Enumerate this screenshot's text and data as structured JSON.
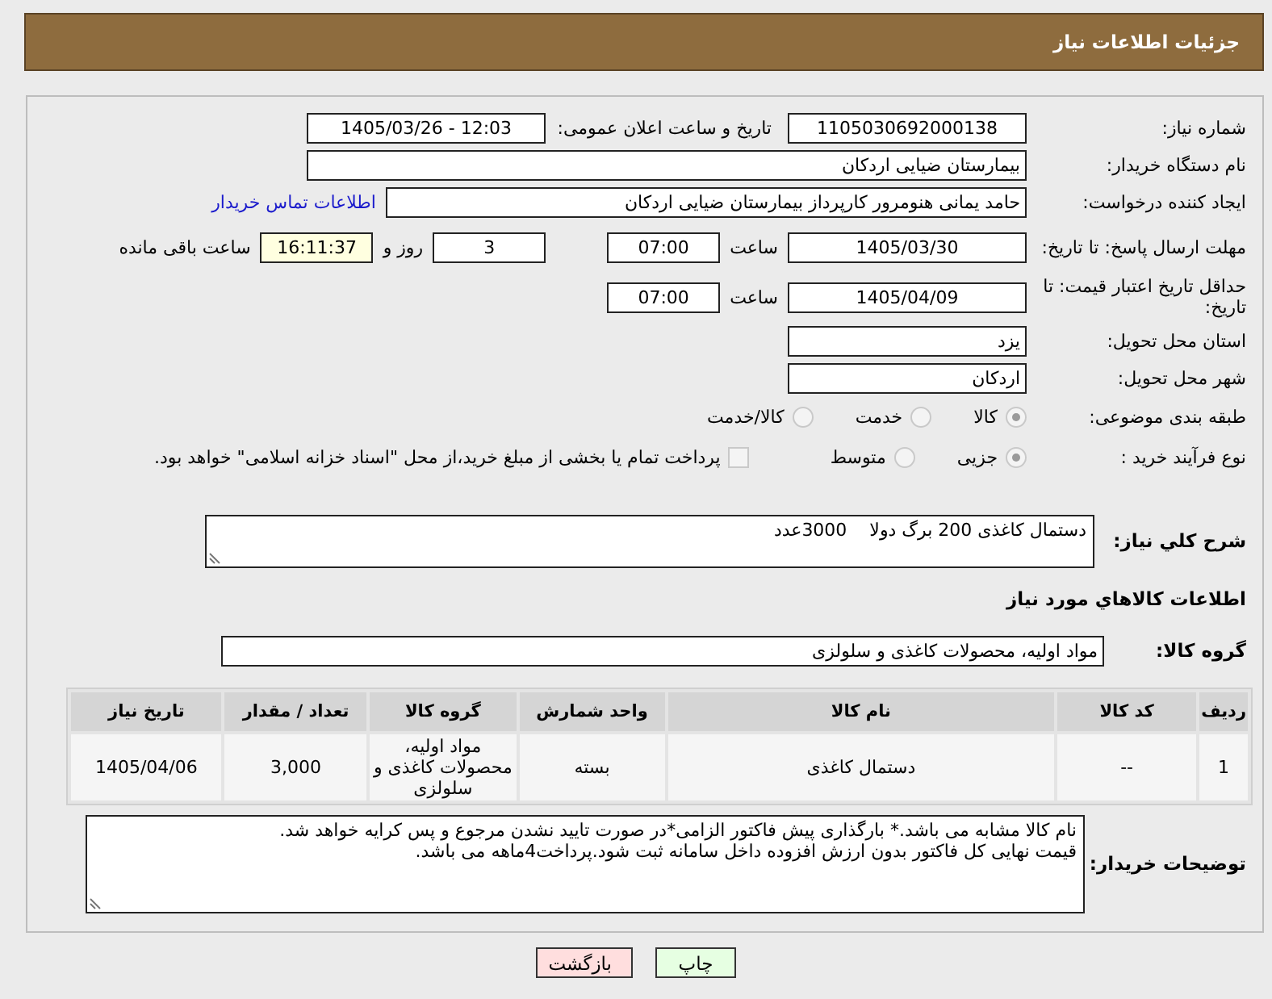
{
  "header": {
    "title": "جزئیات اطلاعات نیاز"
  },
  "need_number": {
    "label": "شماره نیاز:",
    "value": "1105030692000138"
  },
  "announce": {
    "label": "تاریخ و ساعت اعلان عمومی:",
    "value": "1405/03/26 - 12:03"
  },
  "buyer_org": {
    "label": "نام دستگاه خریدار:",
    "value": "بیمارستان ضیایی اردکان"
  },
  "requester": {
    "label": "ایجاد کننده درخواست:",
    "value": "حامد یمانی هنومرور کارپرداز بیمارستان ضیایی اردکان",
    "link": "اطلاعات تماس خریدار"
  },
  "reply_deadline": {
    "label": "مهلت ارسال پاسخ: تا تاریخ:",
    "date": "1405/03/30",
    "time_label": "ساعت",
    "time": "07:00",
    "days": "3",
    "days_label": "روز و",
    "remaining": "16:11:37",
    "remaining_label": "ساعت باقی مانده"
  },
  "price_validity": {
    "label": "حداقل تاریخ اعتبار قیمت: تا تاریخ:",
    "date": "1405/04/09",
    "time_label": "ساعت",
    "time": "07:00"
  },
  "province": {
    "label": "استان محل تحویل:",
    "value": "یزد"
  },
  "city": {
    "label": "شهر محل تحویل:",
    "value": "اردکان"
  },
  "category": {
    "label": "طبقه بندی موضوعی:",
    "options": [
      {
        "label": "کالا",
        "selected": true
      },
      {
        "label": "خدمت",
        "selected": false
      },
      {
        "label": "کالا/خدمت",
        "selected": false
      }
    ]
  },
  "process": {
    "label": "نوع فرآیند خرید :",
    "options": [
      {
        "label": "جزیی",
        "selected": true
      },
      {
        "label": "متوسط",
        "selected": false
      }
    ],
    "payment": {
      "label": "پرداخت تمام یا بخشی از مبلغ خرید،از محل \"اسناد خزانه اسلامی\" خواهد بود.",
      "checked": false
    }
  },
  "description": {
    "label": "شرح کلي نياز:",
    "value": "دستمال کاغذی 200 برگ دولا    3000عدد"
  },
  "items_heading": "اطلاعات کالاهاي مورد نياز",
  "goods_group": {
    "label": "گروه کالا:",
    "value": "مواد اولیه، محصولات کاغذی و سلولزی"
  },
  "table": {
    "columns": [
      "ردیف",
      "کد کالا",
      "نام کالا",
      "واحد شمارش",
      "گروه کالا",
      "تعداد / مقدار",
      "تاریخ نیاز"
    ],
    "rows": [
      [
        "1",
        "--",
        "دستمال کاغذی",
        "بسته",
        "مواد اولیه، محصولات کاغذی و سلولزی",
        "3,000",
        "1405/04/06"
      ]
    ]
  },
  "buyer_notes": {
    "label": "توضیحات خریدار:",
    "lines": [
      "نام کالا مشابه می باشد.* بارگذاری پیش فاکتور الزامی*در صورت تایید نشدن مرجوع و پس کرایه خواهد شد.",
      "قیمت نهایی کل فاکتور بدون ارزش افزوده داخل سامانه ثبت شود.پرداخت4ماهه می باشد."
    ]
  },
  "buttons": [
    {
      "label": "چاپ",
      "kind": "print"
    },
    {
      "label": "بازگشت",
      "kind": "back"
    }
  ]
}
